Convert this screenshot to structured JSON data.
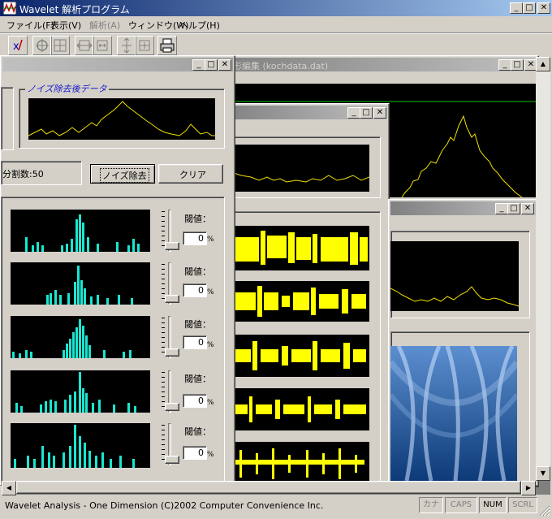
{
  "app": {
    "title": "Wavelet 解析プログラム",
    "status_text": "Wavelet Analysis - One Dimension (C)2002  Computer Convenience Inc.",
    "indicators": [
      "カナ",
      "CAPS",
      "NUM",
      "SCRL"
    ]
  },
  "menu": {
    "items": [
      "ファイル(F)",
      "表示(V)",
      "解析(A)",
      "ウィンドウ(W)",
      "ヘルプ(H)"
    ]
  },
  "toolbar": {
    "icons": [
      "wavelet-icon",
      "zoom-in-icon",
      "zoom-fit-icon",
      "expand-horizontal-icon",
      "shrink-horizontal-icon",
      "expand-vertical-icon",
      "shrink-vertical-icon",
      "print-icon"
    ]
  },
  "windows": {
    "waveform": {
      "title": "形編集 (kochdata.dat)"
    },
    "noise": {
      "group_label": "ノイズ除去後データ",
      "division_label": "分割数:50",
      "denoise_button": "ノイズ除去",
      "clear_button": "クリア",
      "rows": [
        {
          "threshold_label": "閾値：",
          "value": "0",
          "unit": "%"
        },
        {
          "threshold_label": "閾値：",
          "value": "0",
          "unit": "%"
        },
        {
          "threshold_label": "閾値：",
          "value": "0",
          "unit": "%"
        },
        {
          "threshold_label": "閾値：",
          "value": "0",
          "unit": "%"
        },
        {
          "threshold_label": "閾値：",
          "value": "0",
          "unit": "%"
        }
      ]
    }
  },
  "colors": {
    "titlebar_active": "#0a246a",
    "plot_line": "#f0e000",
    "histogram": "#19e6d2",
    "wave": "#ffff00",
    "face": "#d4d0c8"
  }
}
